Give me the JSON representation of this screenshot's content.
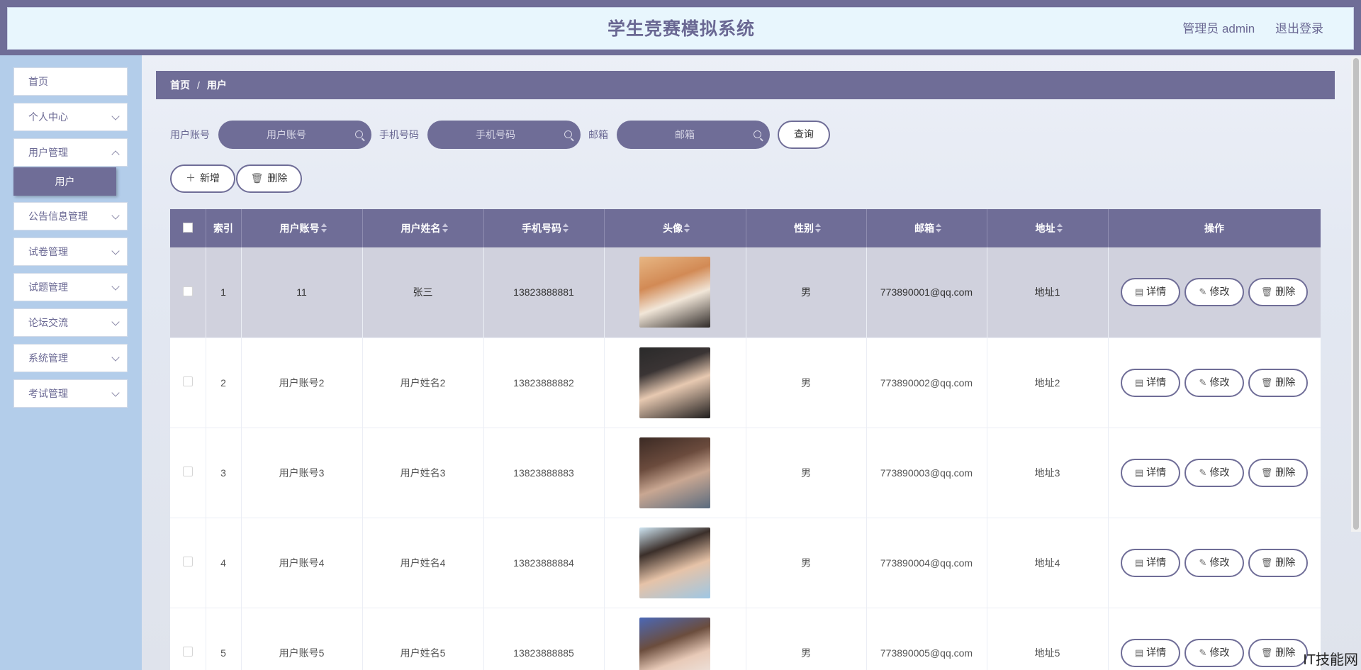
{
  "header": {
    "title": "学生竞赛模拟系统",
    "user_label": "管理员 admin",
    "logout_label": "退出登录"
  },
  "sidebar": {
    "items": [
      {
        "label": "首页",
        "has_arrow": false
      },
      {
        "label": "个人中心",
        "has_arrow": true
      },
      {
        "label": "用户管理",
        "has_arrow": true
      },
      {
        "label": "公告信息管理",
        "has_arrow": true
      },
      {
        "label": "试卷管理",
        "has_arrow": true
      },
      {
        "label": "试题管理",
        "has_arrow": true
      },
      {
        "label": "论坛交流",
        "has_arrow": true
      },
      {
        "label": "系统管理",
        "has_arrow": true
      },
      {
        "label": "考试管理",
        "has_arrow": true
      }
    ],
    "active_sub": "用户"
  },
  "breadcrumb": {
    "home": "首页",
    "separator": "/",
    "current": "用户"
  },
  "search": {
    "account_label": "用户账号",
    "account_placeholder": "用户账号",
    "phone_label": "手机号码",
    "phone_placeholder": "手机号码",
    "email_label": "邮箱",
    "email_placeholder": "邮箱",
    "query_label": "查询"
  },
  "actions": {
    "add_label": "新增",
    "delete_label": "删除"
  },
  "table": {
    "headers": [
      "索引",
      "用户账号",
      "用户姓名",
      "手机号码",
      "头像",
      "性别",
      "邮箱",
      "地址",
      "操作"
    ],
    "rows": [
      {
        "index": "1",
        "account": "11",
        "name": "张三",
        "phone": "13823888881",
        "gender": "男",
        "email": "773890001@qq.com",
        "address": "地址1"
      },
      {
        "index": "2",
        "account": "用户账号2",
        "name": "用户姓名2",
        "phone": "13823888882",
        "gender": "男",
        "email": "773890002@qq.com",
        "address": "地址2"
      },
      {
        "index": "3",
        "account": "用户账号3",
        "name": "用户姓名3",
        "phone": "13823888883",
        "gender": "男",
        "email": "773890003@qq.com",
        "address": "地址3"
      },
      {
        "index": "4",
        "account": "用户账号4",
        "name": "用户姓名4",
        "phone": "13823888884",
        "gender": "男",
        "email": "773890004@qq.com",
        "address": "地址4"
      },
      {
        "index": "5",
        "account": "用户账号5",
        "name": "用户姓名5",
        "phone": "13823888885",
        "gender": "男",
        "email": "773890005@qq.com",
        "address": "地址5"
      }
    ],
    "row_actions": {
      "detail": "详情",
      "edit": "修改",
      "delete": "删除"
    }
  },
  "colors": {
    "accent": "#6f6d97",
    "sidebar_bg": "#b3cdea",
    "header_bg": "#e8f6fd",
    "row_highlight": "#d0d1dd"
  },
  "watermark": "IT技能网"
}
